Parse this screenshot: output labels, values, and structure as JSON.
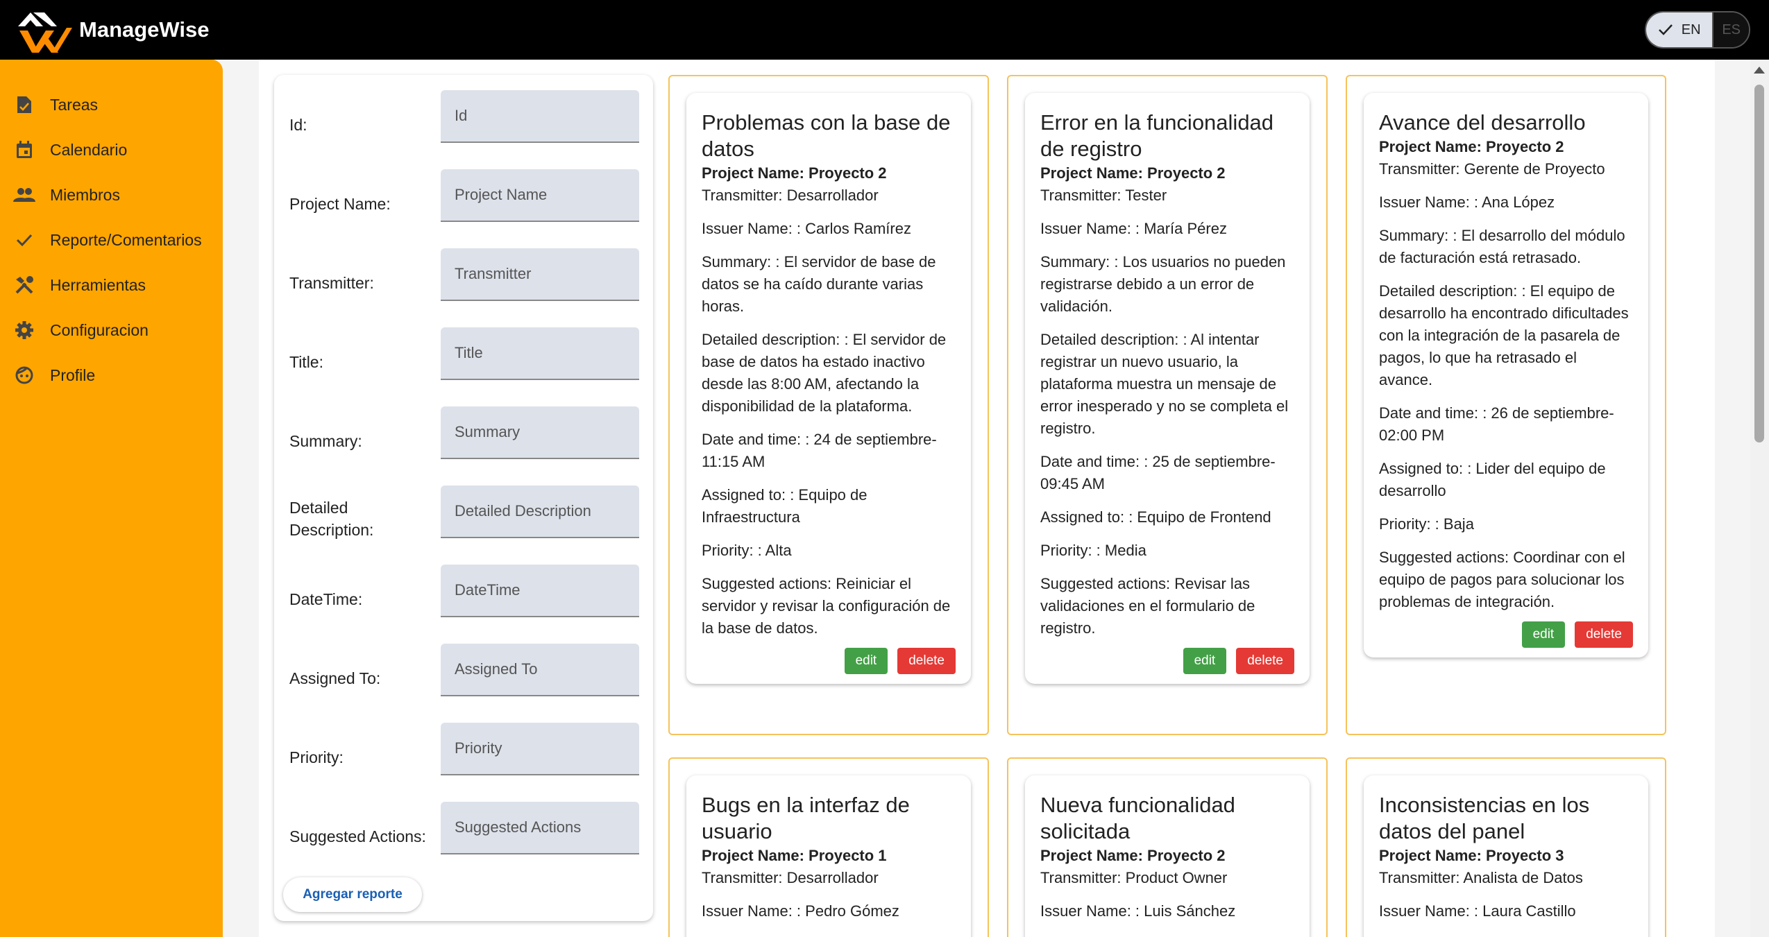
{
  "app": {
    "name": "ManageWise"
  },
  "language": {
    "active": "EN",
    "inactive": "ES"
  },
  "sidebar": {
    "items": [
      {
        "label": "Tareas",
        "icon": "task-document-icon"
      },
      {
        "label": "Calendario",
        "icon": "calendar-icon"
      },
      {
        "label": "Miembros",
        "icon": "people-icon"
      },
      {
        "label": "Reporte/Comentarios",
        "icon": "check-icon"
      },
      {
        "label": "Herramientas",
        "icon": "tools-icon"
      },
      {
        "label": "Configuracion",
        "icon": "gear-icon"
      },
      {
        "label": "Profile",
        "icon": "face-icon"
      }
    ]
  },
  "form": {
    "fields": [
      {
        "label": "Id:",
        "placeholder": "Id",
        "value": ""
      },
      {
        "label": "Project Name:",
        "placeholder": "Project Name",
        "value": ""
      },
      {
        "label": "Transmitter:",
        "placeholder": "Transmitter",
        "value": ""
      },
      {
        "label": "Title:",
        "placeholder": "Title",
        "value": ""
      },
      {
        "label": "Summary:",
        "placeholder": "Summary",
        "value": ""
      },
      {
        "label": "Detailed Description:",
        "placeholder": "Detailed Description",
        "value": ""
      },
      {
        "label": "DateTime:",
        "placeholder": "DateTime",
        "value": ""
      },
      {
        "label": "Assigned To:",
        "placeholder": "Assigned To",
        "value": ""
      },
      {
        "label": "Priority:",
        "placeholder": "Priority",
        "value": ""
      },
      {
        "label": "Suggested Actions:",
        "placeholder": "Suggested Actions",
        "value": ""
      }
    ],
    "submit_label": "Agregar reporte"
  },
  "reports": [
    {
      "title": "Problemas con la base de datos",
      "project": "Project Name: Proyecto 2",
      "transmitter": "Transmitter: Desarrollador",
      "issuer": "Issuer Name: : Carlos Ramírez",
      "summary": "Summary: : El servidor de base de datos se ha caído durante varias horas.",
      "description": "Detailed description: : El servidor de base de datos ha estado inactivo desde las 8:00 AM, afectando la disponibilidad de la plataforma.",
      "datetime": "Date and time: : 24 de septiembre-11:15 AM",
      "assigned": "Assigned to: : Equipo de Infraestructura",
      "priority": "Priority: : Alta",
      "actions": "Suggested actions: Reiniciar el servidor y revisar la configuración de la base de datos.",
      "edit_label": "edit",
      "delete_label": "delete"
    },
    {
      "title": "Error en la funcionalidad de registro",
      "project": "Project Name: Proyecto 2",
      "transmitter": "Transmitter: Tester",
      "issuer": "Issuer Name: : María Pérez",
      "summary": "Summary: : Los usuarios no pueden registrarse debido a un error de validación.",
      "description": "Detailed description: : Al intentar registrar un nuevo usuario, la plataforma muestra un mensaje de error inesperado y no se completa el registro.",
      "datetime": "Date and time: : 25 de septiembre-09:45 AM",
      "assigned": "Assigned to: : Equipo de Frontend",
      "priority": "Priority: : Media",
      "actions": "Suggested actions: Revisar las validaciones en el formulario de registro.",
      "edit_label": "edit",
      "delete_label": "delete"
    },
    {
      "title": "Avance del desarrollo",
      "project": "Project Name: Proyecto 2",
      "transmitter": "Transmitter: Gerente de Proyecto",
      "issuer": "Issuer Name: : Ana López",
      "summary": "Summary: : El desarrollo del módulo de facturación está retrasado.",
      "description": "Detailed description: : El equipo de desarrollo ha encontrado dificultades con la integración de la pasarela de pagos, lo que ha retrasado el avance.",
      "datetime": "Date and time: : 26 de septiembre-02:00 PM",
      "assigned": "Assigned to: : Lider del equipo de desarrollo",
      "priority": "Priority: : Baja",
      "actions": "Suggested actions: Coordinar con el equipo de pagos para solucionar los problemas de integración.",
      "edit_label": "edit",
      "delete_label": "delete"
    },
    {
      "title": "Bugs en la interfaz de usuario",
      "project": "Project Name: Proyecto 1",
      "transmitter": "Transmitter: Desarrollador",
      "issuer": "Issuer Name: : Pedro Gómez"
    },
    {
      "title": "Nueva funcionalidad solicitada",
      "project": "Project Name: Proyecto 2",
      "transmitter": "Transmitter: Product Owner",
      "issuer": "Issuer Name: : Luis Sánchez"
    },
    {
      "title": "Inconsistencias en los datos del panel",
      "project": "Project Name: Proyecto 3",
      "transmitter": "Transmitter: Analista de Datos",
      "issuer": "Issuer Name: : Laura Castillo"
    }
  ],
  "colors": {
    "topbar": "#000000",
    "sidebar": "#ffa500",
    "card_border": "#f5c35c",
    "edit": "#43a047",
    "delete": "#e53935",
    "link": "#1a5fb4"
  }
}
